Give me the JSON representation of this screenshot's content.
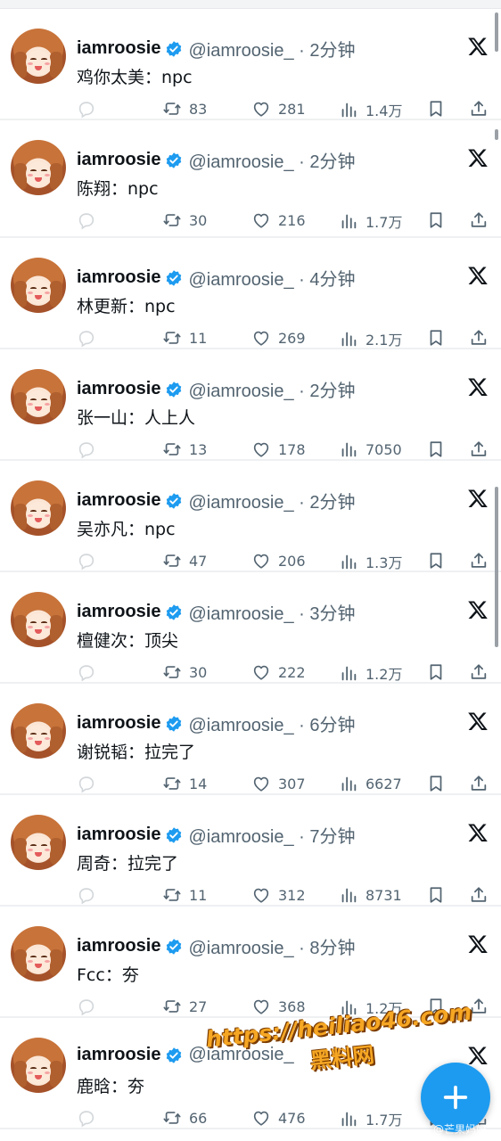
{
  "colors": {
    "accent": "#1d9bf0",
    "text_primary": "#0f1419",
    "text_secondary": "#536471",
    "watermark": "#f5a623"
  },
  "tweets": [
    {
      "name": "iamroosie",
      "handle": "@iamroosie_ · 2分钟",
      "text": "鸡你太美：npc",
      "retweets": "83",
      "likes": "281",
      "views": "1.4万"
    },
    {
      "name": "iamroosie",
      "handle": "@iamroosie_ · 2分钟",
      "text": "陈翔：npc",
      "retweets": "30",
      "likes": "216",
      "views": "1.7万"
    },
    {
      "name": "iamroosie",
      "handle": "@iamroosie_ · 4分钟",
      "text": "林更新：npc",
      "retweets": "11",
      "likes": "269",
      "views": "2.1万"
    },
    {
      "name": "iamroosie",
      "handle": "@iamroosie_ · 2分钟",
      "text": "张一山：人上人",
      "retweets": "13",
      "likes": "178",
      "views": "7050"
    },
    {
      "name": "iamroosie",
      "handle": "@iamroosie_ · 2分钟",
      "text": "吴亦凡：npc",
      "retweets": "47",
      "likes": "206",
      "views": "1.3万"
    },
    {
      "name": "iamroosie",
      "handle": "@iamroosie_ · 3分钟",
      "text": "檀健次：顶尖",
      "retweets": "30",
      "likes": "222",
      "views": "1.2万"
    },
    {
      "name": "iamroosie",
      "handle": "@iamroosie_ · 6分钟",
      "text": "谢锐韬：拉完了",
      "retweets": "14",
      "likes": "307",
      "views": "6627"
    },
    {
      "name": "iamroosie",
      "handle": "@iamroosie_ · 7分钟",
      "text": "周奇：拉完了",
      "retweets": "11",
      "likes": "312",
      "views": "8731"
    },
    {
      "name": "iamroosie",
      "handle": "@iamroosie_ · 8分钟",
      "text": "Fcc：夯",
      "retweets": "27",
      "likes": "368",
      "views": "1.2万"
    },
    {
      "name": "iamroosie",
      "handle": "@iamroosie_",
      "text": "鹿晗：夯",
      "retweets": "66",
      "likes": "476",
      "views": "1.7万"
    }
  ],
  "watermark": {
    "url": "https://heiliao46.com",
    "label": "黑料网"
  },
  "credit": "@芒果妈妈",
  "icons": {
    "verified": "verified-badge-icon",
    "x_logo": "x-logo-icon",
    "reply": "reply-icon",
    "retweet": "retweet-icon",
    "like": "heart-icon",
    "views": "views-icon",
    "bookmark": "bookmark-icon",
    "share": "share-icon",
    "compose": "plus-icon"
  }
}
